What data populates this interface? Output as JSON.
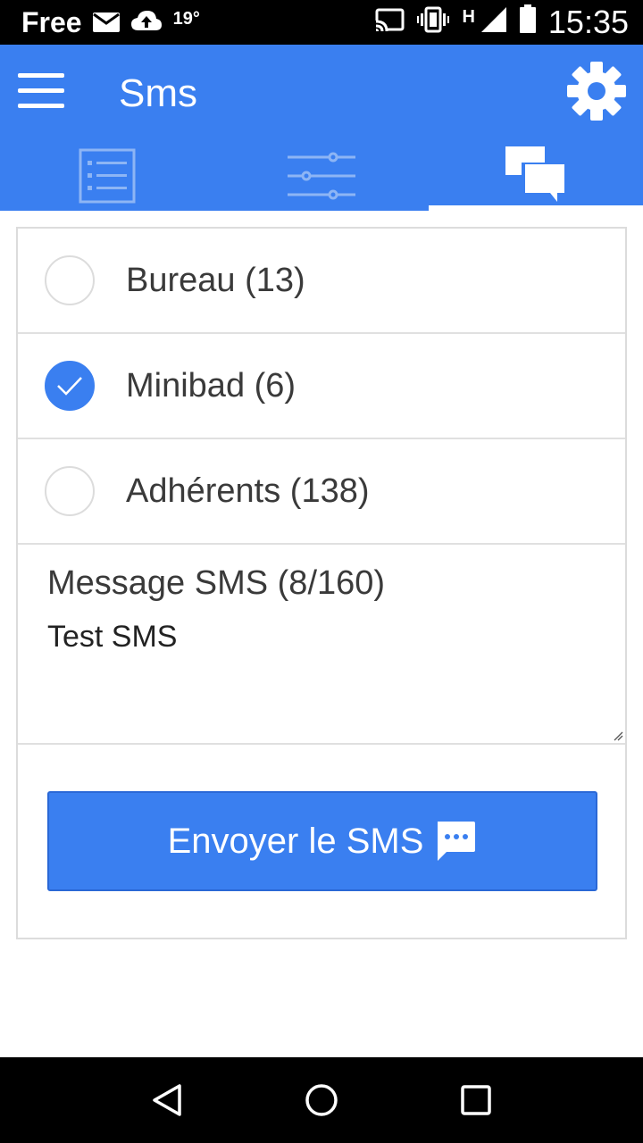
{
  "status_bar": {
    "carrier": "Free",
    "temperature": "19°",
    "network": "H",
    "time": "15:35",
    "icons": [
      "mail-icon",
      "cloud-upload-icon",
      "cast-icon",
      "vibrate-icon",
      "signal-icon",
      "battery-icon"
    ]
  },
  "app_bar": {
    "title": "Sms",
    "background": "#3a7ff0",
    "tabs": [
      {
        "icon": "list-icon",
        "active": false
      },
      {
        "icon": "sliders-icon",
        "active": false
      },
      {
        "icon": "chat-bubbles-icon",
        "active": true
      }
    ]
  },
  "groups": [
    {
      "label": "Bureau (13)",
      "checked": false
    },
    {
      "label": "Minibad (6)",
      "checked": true
    },
    {
      "label": "Adhérents (138)",
      "checked": false
    }
  ],
  "message": {
    "label": "Message SMS (8/160)",
    "value": "Test SMS"
  },
  "send_button": {
    "label": "Envoyer le SMS",
    "icon": "sms-bubble-icon"
  },
  "nav_bar": {
    "icons": [
      "back-icon",
      "home-icon",
      "recents-icon"
    ]
  }
}
